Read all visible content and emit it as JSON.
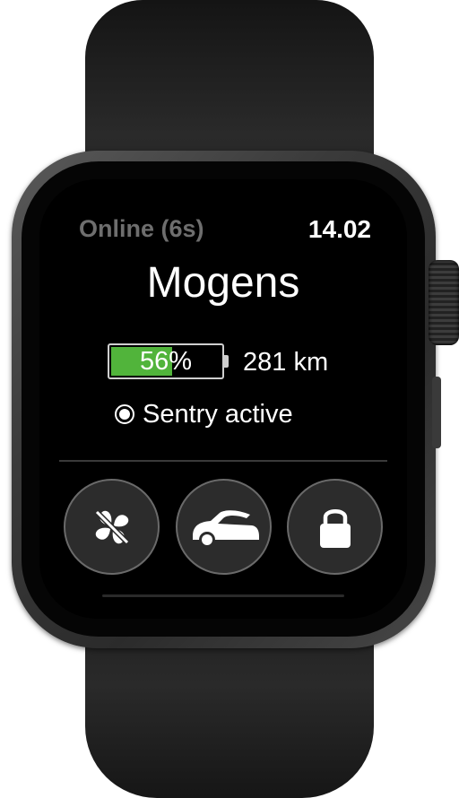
{
  "status": {
    "connection_text": "Online (6s)",
    "clock_text": "14.02"
  },
  "vehicle": {
    "name": "Mogens",
    "battery_percent_label": "56%",
    "battery_level": 0.56,
    "range_text": "281 km",
    "sentry_text": "Sentry active"
  },
  "actions": [
    {
      "id": "climate",
      "icon": "fan-off-icon"
    },
    {
      "id": "trunk",
      "icon": "car-trunk-open-icon"
    },
    {
      "id": "lock",
      "icon": "lock-icon"
    }
  ],
  "colors": {
    "battery_fill": "#51b43b",
    "status_text": "#6e6e6e",
    "button_bg": "#2c2c2c",
    "button_border": "#6a6a6a"
  }
}
